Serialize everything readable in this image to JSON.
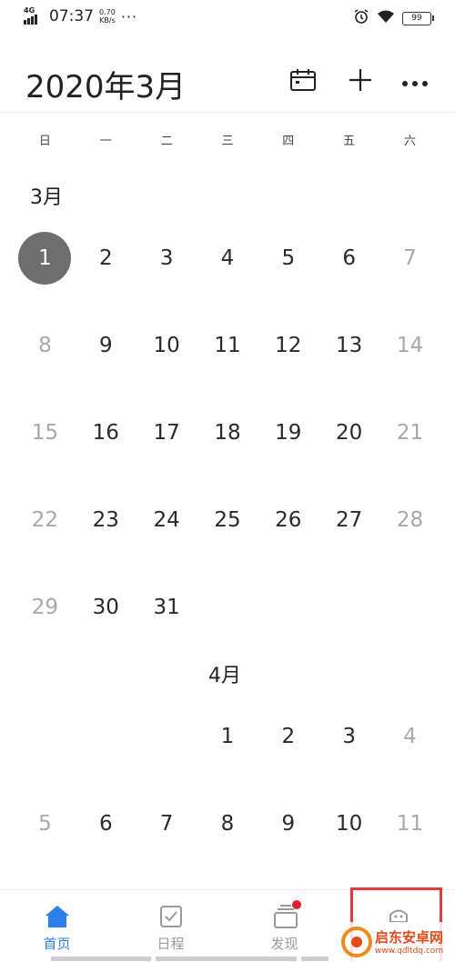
{
  "status_bar": {
    "network": "4G",
    "time": "07:37",
    "speed_value": "0.70",
    "speed_unit": "KB/s",
    "more": "···",
    "battery": "99"
  },
  "header": {
    "title": "2020年3月",
    "icons": [
      "calendar-icon",
      "plus-icon",
      "more-icon"
    ]
  },
  "weekdays": [
    "日",
    "一",
    "二",
    "三",
    "四",
    "五",
    "六"
  ],
  "months": [
    {
      "label": "3月",
      "weeks": [
        [
          "1",
          "2",
          "3",
          "4",
          "5",
          "6",
          "7"
        ],
        [
          "8",
          "9",
          "10",
          "11",
          "12",
          "13",
          "14"
        ],
        [
          "15",
          "16",
          "17",
          "18",
          "19",
          "20",
          "21"
        ],
        [
          "22",
          "23",
          "24",
          "25",
          "26",
          "27",
          "28"
        ],
        [
          "29",
          "30",
          "31",
          "",
          "",
          "",
          ""
        ]
      ],
      "today": "1"
    },
    {
      "label": "4月",
      "weeks": [
        [
          "",
          "",
          "",
          "1",
          "2",
          "3",
          "4"
        ],
        [
          "5",
          "6",
          "7",
          "8",
          "9",
          "10",
          "11"
        ]
      ]
    }
  ],
  "tabs": [
    {
      "label": "首页",
      "icon": "home-icon",
      "active": true
    },
    {
      "label": "日程",
      "icon": "checkbox-icon",
      "active": false
    },
    {
      "label": "发现",
      "icon": "cards-icon",
      "active": false
    },
    {
      "label": "",
      "icon": "me-icon",
      "active": false
    }
  ],
  "colors": {
    "accent": "#2f7ee8",
    "today_circle": "#6e6e6e",
    "highlight_box": "#e23b3b",
    "badge": "#e5202a"
  },
  "watermark": {
    "name": "启东安卓网",
    "url": "www.qdltdq.com"
  }
}
